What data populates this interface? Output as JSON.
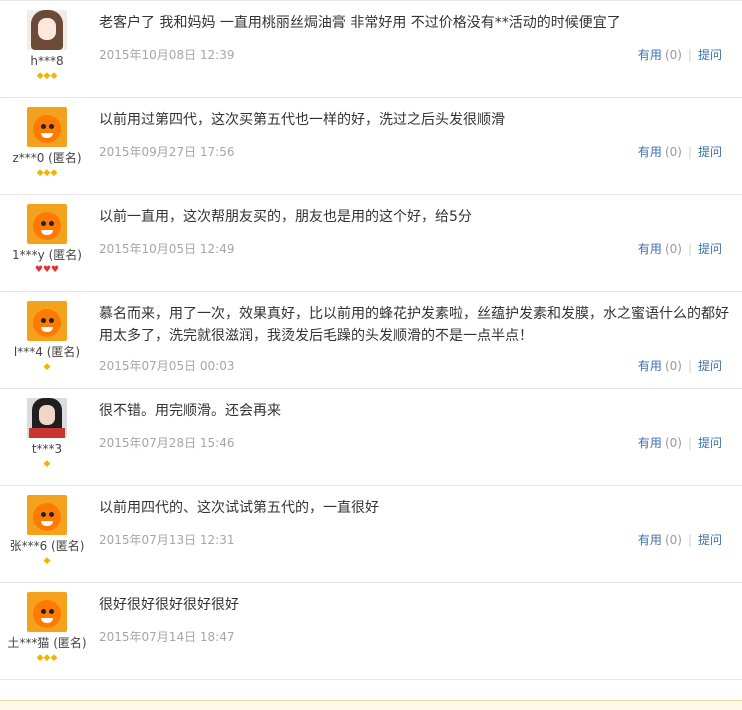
{
  "reviews": [
    {
      "username": "h***8",
      "badges": [
        "diamond",
        "diamond",
        "diamond"
      ],
      "avatar": "girl1",
      "content": "老客户了 我和妈妈 一直用桃丽丝焗油膏 非常好用 不过价格没有**活动的时候便宜了",
      "date": "2015年10月08日 12:39",
      "useful_label": "有用",
      "useful_count": "(0)",
      "ask_label": "提问"
    },
    {
      "username": "z***0 (匿名)",
      "badges": [
        "diamond",
        "diamond",
        "diamond"
      ],
      "avatar": "tao",
      "content": "以前用过第四代，这次买第五代也一样的好，洗过之后头发很顺滑",
      "date": "2015年09月27日 17:56",
      "useful_label": "有用",
      "useful_count": "(0)",
      "ask_label": "提问"
    },
    {
      "username": "1***y (匿名)",
      "badges": [
        "heart",
        "heart",
        "heart"
      ],
      "avatar": "tao",
      "content": "以前一直用，这次帮朋友买的，朋友也是用的这个好，给5分",
      "date": "2015年10月05日 12:49",
      "useful_label": "有用",
      "useful_count": "(0)",
      "ask_label": "提问"
    },
    {
      "username": "l***4 (匿名)",
      "badges": [
        "diamond"
      ],
      "avatar": "tao",
      "content": "慕名而来，用了一次，效果真好，比以前用的蜂花护发素啦，丝蕴护发素和发膜，水之蜜语什么的都好用太多了，洗完就很滋润，我烫发后毛躁的头发顺滑的不是一点半点！",
      "date": "2015年07月05日 00:03",
      "useful_label": "有用",
      "useful_count": "(0)",
      "ask_label": "提问"
    },
    {
      "username": "t***3",
      "badges": [
        "diamond"
      ],
      "avatar": "girl2",
      "content": "很不错。用完顺滑。还会再来",
      "date": "2015年07月28日 15:46",
      "useful_label": "有用",
      "useful_count": "(0)",
      "ask_label": "提问"
    },
    {
      "username": "张***6 (匿名)",
      "badges": [
        "diamond"
      ],
      "avatar": "tao",
      "content": "以前用四代的、这次试试第五代的，一直很好",
      "date": "2015年07月13日 12:31",
      "useful_label": "有用",
      "useful_count": "(0)",
      "ask_label": "提问"
    },
    {
      "username": "土***猫 (匿名)",
      "badges": [
        "diamond",
        "diamond",
        "diamond"
      ],
      "avatar": "tao",
      "content": "很好很好很好很好很好",
      "date": "2015年07月14日 18:47",
      "useful_label": "",
      "useful_count": "",
      "ask_label": ""
    }
  ]
}
